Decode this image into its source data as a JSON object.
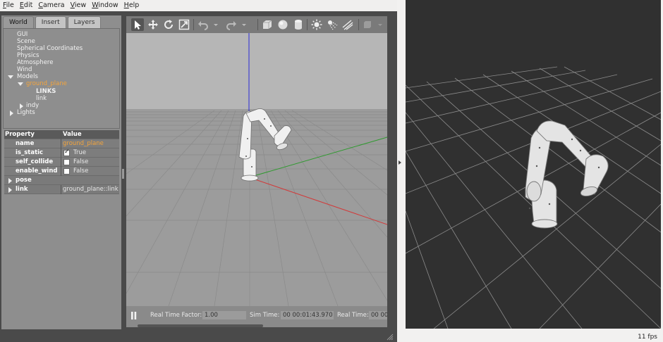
{
  "menubar": {
    "items": [
      {
        "first": "F",
        "rest": "ile"
      },
      {
        "first": "E",
        "rest": "dit"
      },
      {
        "first": "C",
        "rest": "amera"
      },
      {
        "first": "V",
        "rest": "iew"
      },
      {
        "first": "W",
        "rest": "indow"
      },
      {
        "first": "H",
        "rest": "elp"
      }
    ]
  },
  "left_panel": {
    "tabs": [
      "World",
      "Insert",
      "Layers"
    ],
    "active_tab": "World",
    "tree": {
      "gui": "GUI",
      "scene": "Scene",
      "spherical": "Spherical Coordinates",
      "physics": "Physics",
      "atmosphere": "Atmosphere",
      "wind": "Wind",
      "models": "Models",
      "ground_plane": "ground_plane",
      "links_header": "LINKS",
      "link": "link",
      "indy": "indy",
      "lights": "Lights"
    },
    "properties": {
      "header_property": "Property",
      "header_value": "Value",
      "name_key": "name",
      "name_value": "ground_plane",
      "is_static_key": "is_static",
      "is_static_value": "True",
      "self_collide_key": "self_collide",
      "self_collide_value": "False",
      "enable_wind_key": "enable_wind",
      "enable_wind_value": "False",
      "pose_key": "pose",
      "link_key": "link",
      "link_value": "ground_plane::link"
    }
  },
  "toolbar": {
    "icons": [
      "select-icon",
      "translate-icon",
      "rotate-icon",
      "scale-icon",
      "undo-icon",
      "redo-icon",
      "box-icon",
      "sphere-icon",
      "cylinder-icon",
      "point-light-icon",
      "spot-light-icon",
      "directional-light-icon",
      "copy-icon"
    ]
  },
  "status": {
    "rtf_label": "Real Time Factor:",
    "rtf_value": "1.00",
    "sim_label": "Sim Time:",
    "sim_value": "00 00:01:43.970",
    "real_label": "Real Time:",
    "real_value": "00 00"
  },
  "rviz": {
    "fps": "11 fps"
  },
  "colors": {
    "selected": "#f3a43c",
    "x_axis": "#d23a3a",
    "y_axis": "#2f9a2f",
    "z_axis": "#2a2ad8",
    "sky": "#b6b6b6",
    "rviz_bg": "#303030"
  }
}
